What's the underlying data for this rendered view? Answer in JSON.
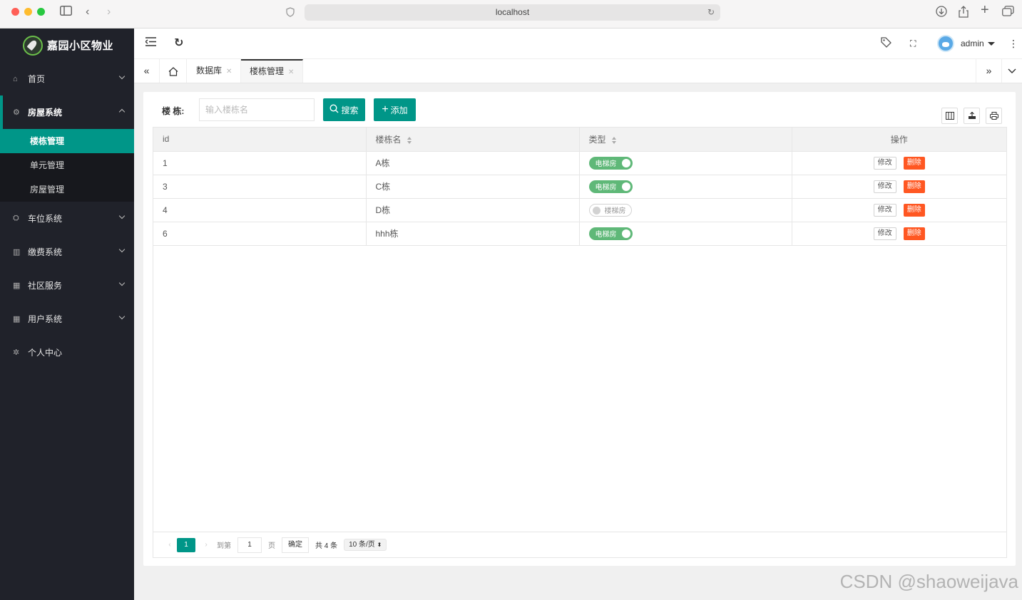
{
  "browser": {
    "url": "localhost",
    "colors": {
      "close": "#ff5f57",
      "minimize": "#febc2e",
      "zoom": "#28c840"
    }
  },
  "sidebar": {
    "logo_text": "嘉园小区物业",
    "menu": [
      {
        "label": "首页",
        "icon": "home-icon"
      },
      {
        "label": "房屋系统",
        "icon": "gear-icon",
        "open": true,
        "children": [
          {
            "label": "楼栋管理",
            "active": true
          },
          {
            "label": "单元管理"
          },
          {
            "label": "房屋管理"
          }
        ]
      },
      {
        "label": "车位系统",
        "icon": "car-icon"
      },
      {
        "label": "缴费系统",
        "icon": "payment-icon"
      },
      {
        "label": "社区服务",
        "icon": "apps-icon"
      },
      {
        "label": "用户系统",
        "icon": "users-icon"
      },
      {
        "label": "个人中心",
        "icon": "settings-icon"
      }
    ]
  },
  "header": {
    "username": "admin"
  },
  "tabs": [
    {
      "label": "数据库"
    },
    {
      "label": "楼栋管理",
      "active": true
    }
  ],
  "search": {
    "label": "楼 栋:",
    "placeholder": "输入楼栋名",
    "search_button": "搜索",
    "add_button": "添加"
  },
  "table": {
    "columns": [
      "id",
      "楼栋名",
      "类型",
      "操作"
    ],
    "rows": [
      {
        "id": "1",
        "name": "A栋",
        "type": "电梯房",
        "elevator": true
      },
      {
        "id": "3",
        "name": "C栋",
        "type": "电梯房",
        "elevator": true
      },
      {
        "id": "4",
        "name": "D栋",
        "type": "楼梯房",
        "elevator": false
      },
      {
        "id": "6",
        "name": "hhh栋",
        "type": "电梯房",
        "elevator": true
      }
    ],
    "edit_label": "修改",
    "delete_label": "删除"
  },
  "pagination": {
    "current_page": "1",
    "goto_label": "到第",
    "goto_value": "1",
    "page_label": "页",
    "confirm_label": "确定",
    "total_label": "共 4 条",
    "page_size": "10 条/页"
  },
  "watermark": "CSDN @shaoweijava",
  "colors": {
    "primary": "#009688",
    "sidebar_bg": "#20222a",
    "danger": "#ff5722",
    "switch_on": "#5fb878"
  }
}
